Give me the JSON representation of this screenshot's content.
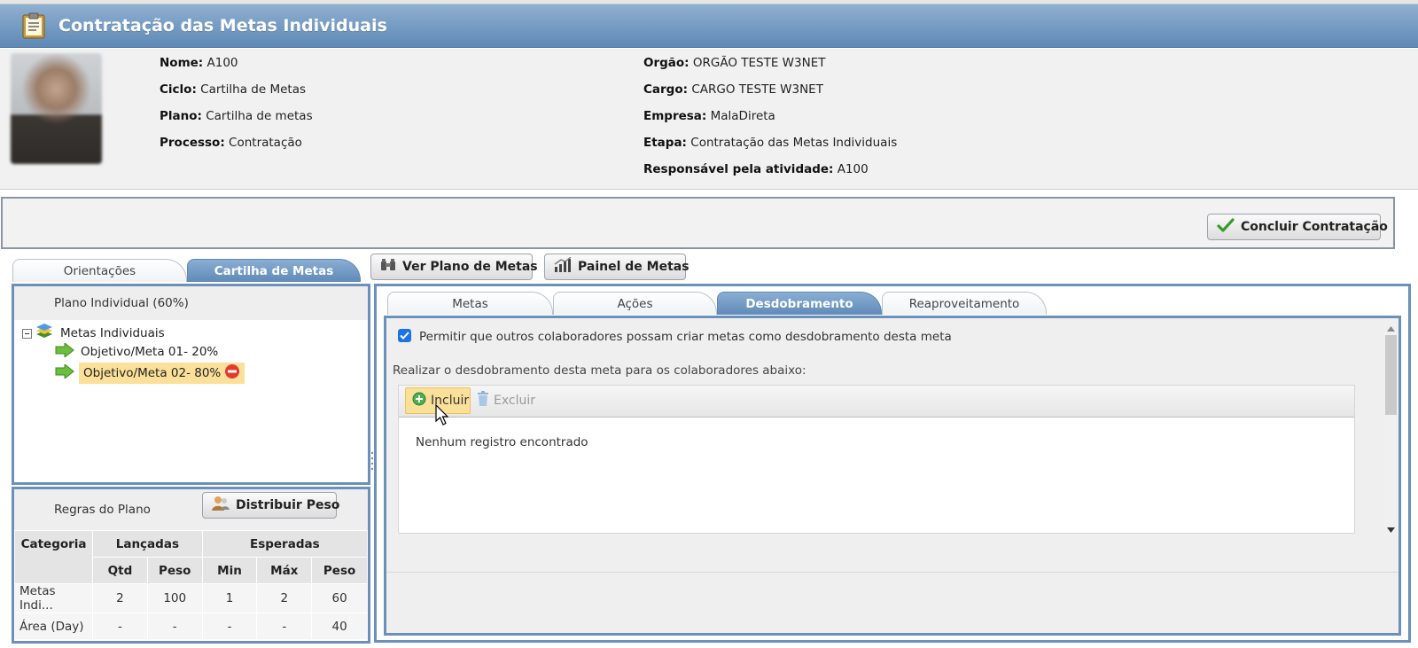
{
  "header": {
    "title": "Contratação das Metas Individuais",
    "icon": "clipboard-icon"
  },
  "info": {
    "nome_label": "Nome:",
    "nome": "A100",
    "ciclo_label": "Ciclo:",
    "ciclo": "Cartilha de Metas",
    "plano_label": "Plano:",
    "plano": "Cartilha de metas",
    "processo_label": "Processo:",
    "processo": "Contratação",
    "orgao_label": "Orgão:",
    "orgao": "ORGÃO TESTE W3NET",
    "cargo_label": "Cargo:",
    "cargo": "CARGO TESTE W3NET",
    "empresa_label": "Empresa:",
    "empresa": "MalaDireta",
    "etapa_label": "Etapa:",
    "etapa": "Contratação das Metas Individuais",
    "responsavel_label": "Responsável pela atividade:",
    "responsavel": "A100"
  },
  "actions": {
    "concluir": "Concluir Contratação"
  },
  "outer_tabs": [
    {
      "label": "Orientações",
      "active": false
    },
    {
      "label": "Cartilha de Metas",
      "active": true
    }
  ],
  "toolbar": {
    "ver_plano": "Ver Plano de Metas",
    "painel": "Painel de Metas"
  },
  "plan_tree": {
    "title": "Plano Individual (60%)",
    "root": "Metas Individuais",
    "items": [
      {
        "label": "Objetivo/Meta 01- 20%",
        "selected": false
      },
      {
        "label": "Objetivo/Meta 02- 80%",
        "selected": true
      }
    ]
  },
  "rules": {
    "title": "Regras do Plano",
    "distribuir": "Distribuir Peso",
    "headers": {
      "categoria": "Categoria",
      "lancadas": "Lançadas",
      "esperadas": "Esperadas"
    },
    "subheaders": [
      "Qtd",
      "Peso",
      "Min",
      "Máx",
      "Peso"
    ],
    "rows": [
      [
        "Metas Indi...",
        "2",
        "100",
        "1",
        "2",
        "60"
      ],
      [
        "Área (Day)",
        "-",
        "-",
        "-",
        "-",
        "40"
      ]
    ]
  },
  "inner_tabs": [
    {
      "label": "Metas",
      "active": false
    },
    {
      "label": "Ações",
      "active": false
    },
    {
      "label": "Desdobramento",
      "active": true
    },
    {
      "label": "Reaproveitamento",
      "active": false
    }
  ],
  "desdobramento": {
    "checkbox_checked": true,
    "checkbox_label": "Permitir que outros colaboradores possam criar metas como desdobramento desta meta",
    "instruction": "Realizar o desdobramento desta meta para os colaboradores abaixo:",
    "incluir": "Incluir",
    "excluir": "Excluir",
    "empty": "Nenhum registro encontrado"
  },
  "colors": {
    "accent": "#6b91ba",
    "header_start": "#8fb0d1",
    "header_end": "#5f89b6",
    "selection": "#fbe09a"
  }
}
